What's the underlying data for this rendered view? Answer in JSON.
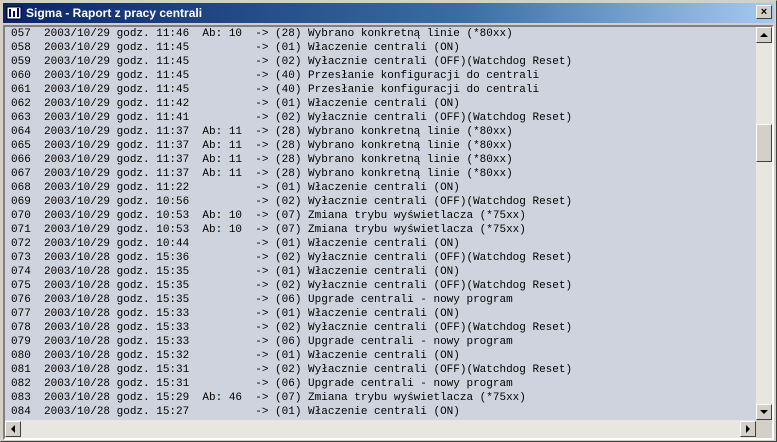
{
  "window": {
    "title": "Sigma - Raport z pracy centrali",
    "icon": "app-grid-icon",
    "close_label": "×"
  },
  "log": {
    "rows": [
      "057  2003/10/29 godz. 11:46  Ab: 10  -> (28) Wybrano konkretną linie (*80xx)",
      "058  2003/10/29 godz. 11:45          -> (01) Właczenie centrali (ON)",
      "059  2003/10/29 godz. 11:45          -> (02) Wyłacznie centrali (OFF)(Watchdog Reset)",
      "060  2003/10/29 godz. 11:45          -> (40) Przesłanie konfiguracji do centrali",
      "061  2003/10/29 godz. 11:45          -> (40) Przesłanie konfiguracji do centrali",
      "062  2003/10/29 godz. 11:42          -> (01) Właczenie centrali (ON)",
      "063  2003/10/29 godz. 11:41          -> (02) Wyłacznie centrali (OFF)(Watchdog Reset)",
      "064  2003/10/29 godz. 11:37  Ab: 11  -> (28) Wybrano konkretną linie (*80xx)",
      "065  2003/10/29 godz. 11:37  Ab: 11  -> (28) Wybrano konkretną linie (*80xx)",
      "066  2003/10/29 godz. 11:37  Ab: 11  -> (28) Wybrano konkretną linie (*80xx)",
      "067  2003/10/29 godz. 11:37  Ab: 11  -> (28) Wybrano konkretną linie (*80xx)",
      "068  2003/10/29 godz. 11:22          -> (01) Właczenie centrali (ON)",
      "069  2003/10/29 godz. 10:56          -> (02) Wyłacznie centrali (OFF)(Watchdog Reset)",
      "070  2003/10/29 godz. 10:53  Ab: 10  -> (07) Zmiana trybu wyświetlacza (*75xx)",
      "071  2003/10/29 godz. 10:53  Ab: 10  -> (07) Zmiana trybu wyświetlacza (*75xx)",
      "072  2003/10/29 godz. 10:44          -> (01) Właczenie centrali (ON)",
      "073  2003/10/28 godz. 15:36          -> (02) Wyłacznie centrali (OFF)(Watchdog Reset)",
      "074  2003/10/28 godz. 15:35          -> (01) Właczenie centrali (ON)",
      "075  2003/10/28 godz. 15:35          -> (02) Wyłacznie centrali (OFF)(Watchdog Reset)",
      "076  2003/10/28 godz. 15:35          -> (06) Upgrade centrali - nowy program",
      "077  2003/10/28 godz. 15:33          -> (01) Właczenie centrali (ON)",
      "078  2003/10/28 godz. 15:33          -> (02) Wyłacznie centrali (OFF)(Watchdog Reset)",
      "079  2003/10/28 godz. 15:33          -> (06) Upgrade centrali - nowy program",
      "080  2003/10/28 godz. 15:32          -> (01) Właczenie centrali (ON)",
      "081  2003/10/28 godz. 15:31          -> (02) Wyłacznie centrali (OFF)(Watchdog Reset)",
      "082  2003/10/28 godz. 15:31          -> (06) Upgrade centrali - nowy program",
      "083  2003/10/28 godz. 15:29  Ab: 46  -> (07) Zmiana trybu wyświetlacza (*75xx)",
      "084  2003/10/28 godz. 15:27          -> (01) Właczenie centrali (ON)"
    ]
  },
  "scrollbars": {
    "vertical_position": 0.25,
    "horizontal_position": 0.0
  }
}
